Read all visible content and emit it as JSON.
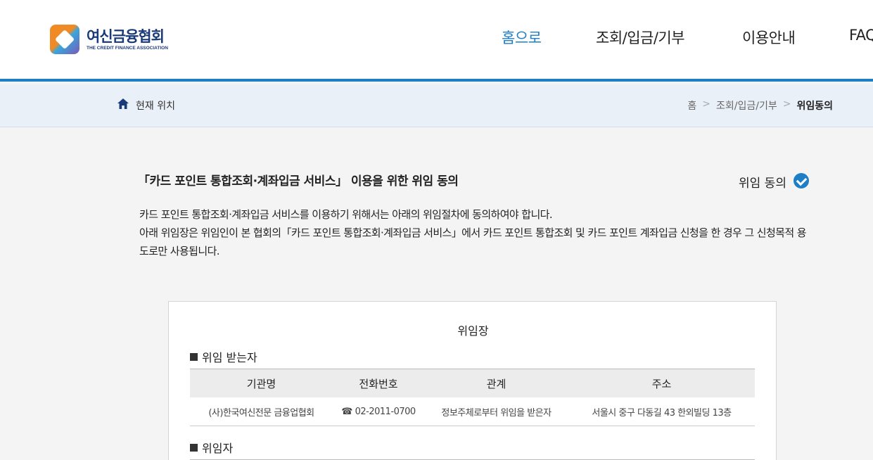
{
  "header": {
    "logo_kr": "여신금융협회",
    "logo_en": "THE CREDIT FINANCE ASSOCIATION",
    "nav": [
      {
        "label": "홈으로",
        "active": true
      },
      {
        "label": "조회/입금/기부",
        "active": false
      },
      {
        "label": "이용안내",
        "active": false
      },
      {
        "label": "FAQ",
        "active": false
      }
    ]
  },
  "location": {
    "icon": "home-icon",
    "label": "현재 위치",
    "crumbs": [
      "홈",
      "조회/입금/기부",
      "위임동의"
    ],
    "separator": ">"
  },
  "main": {
    "title": "「카드 포인트 통합조회·계좌입금 서비스」 이용을 위한 위임 동의",
    "consent_label": "위임 동의",
    "consent_icon": "check-circle-icon",
    "desc_line1": "카드 포인트 통합조회·계좌입금 서비스를 이용하기 위해서는 아래의 위임절차에 동의하여야 합니다.",
    "desc_line2": "아래 위임장은 위임인이 본 협회의「카드 포인트 통합조회·계좌입금 서비스」에서 카드 포인트 통합조회 및 카드 포인트 계좌입금 신청을 한 경우 그 신청목적 용도로만 사용됩니다."
  },
  "document": {
    "title": "위임장",
    "section1": "위임 받는자",
    "columns": [
      "기관명",
      "전화번호",
      "관계",
      "주소"
    ],
    "rows": [
      [
        "(사)한국여신전문 금융업협회",
        "☎ 02-2011-0700",
        "정보주체로부터 위임을 받은자",
        "서울시 중구 다동길 43 한외빌딩 13층"
      ]
    ],
    "section2": "위임자"
  },
  "colors": {
    "accent": "#1e7fc6",
    "location_bg": "#eaf0f8",
    "page_bg": "#f4f4f4"
  }
}
